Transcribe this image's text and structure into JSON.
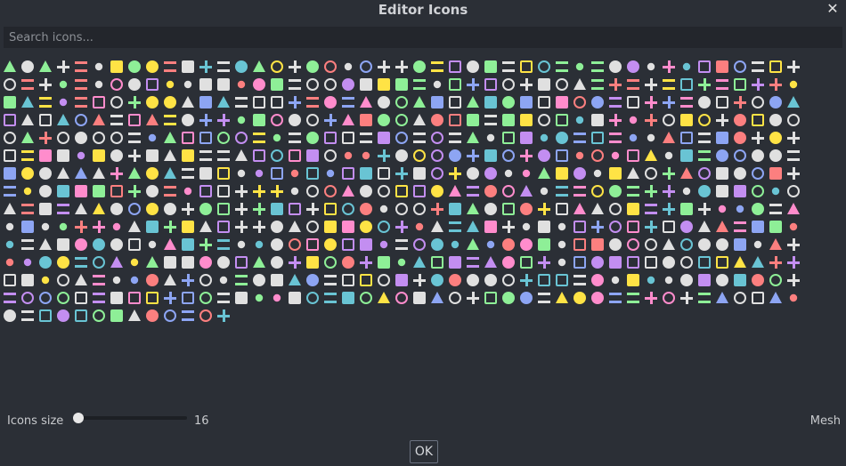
{
  "window": {
    "title": "Editor Icons",
    "close_glyph": "✕"
  },
  "search": {
    "placeholder": "Search icons...",
    "value": ""
  },
  "icon_grid": {
    "palette": [
      "#e0e0e0",
      "#e0e0e0",
      "#e0e0e0",
      "#8da5f3",
      "#8eef97",
      "#fc7f7f",
      "#ffe345",
      "#c38ef1",
      "#ff8ccc",
      "#69c4d4"
    ],
    "row_counts": [
      45,
      45,
      45,
      45,
      45,
      45,
      45,
      45,
      45,
      45,
      45,
      45,
      45,
      45,
      13
    ]
  },
  "footer": {
    "size_label": "Icons size",
    "size_value": "16",
    "size_fraction": 0.0,
    "selected_icon": "Mesh"
  },
  "dialog": {
    "ok_label": "OK"
  }
}
